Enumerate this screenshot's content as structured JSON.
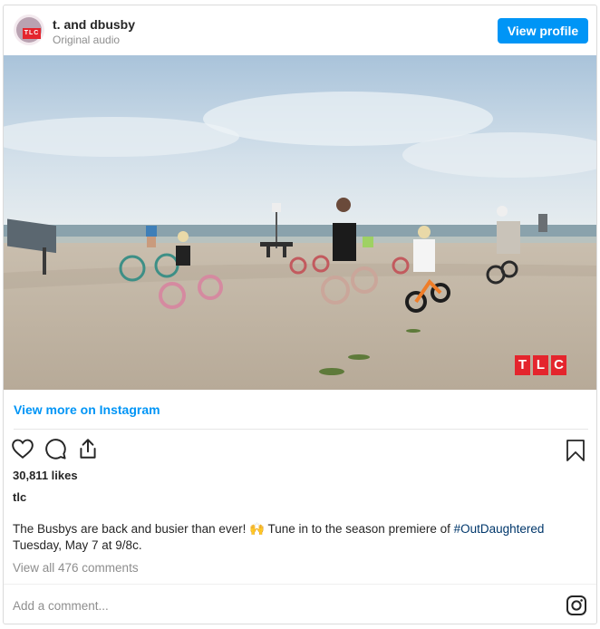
{
  "header": {
    "username": "t.   and dbusby",
    "audio_label": "Original audio",
    "view_profile_label": "View profile"
  },
  "media": {
    "watermark_letters": [
      "T",
      "L",
      "C"
    ],
    "avatar_badge": "TLC"
  },
  "links": {
    "view_more": "View more on Instagram"
  },
  "stats": {
    "likes": "30,811 likes",
    "owner": "tlc"
  },
  "caption": {
    "text_before": "The Busbys are back and busier than ever! ",
    "emoji": "🙌",
    "text_mid": " Tune in to the season premiere of ",
    "hashtag": "#OutDaughtered",
    "text_after": " Tuesday, May 7 at 9/8c."
  },
  "comments": {
    "view_all": "View all 476 comments",
    "placeholder": "Add a comment..."
  },
  "icons": {
    "like": "heart-icon",
    "comment": "comment-icon",
    "share": "share-icon",
    "save": "bookmark-icon",
    "instagram": "instagram-icon"
  },
  "colors": {
    "accent": "#0095f6",
    "tlc_red": "#e4252d"
  }
}
